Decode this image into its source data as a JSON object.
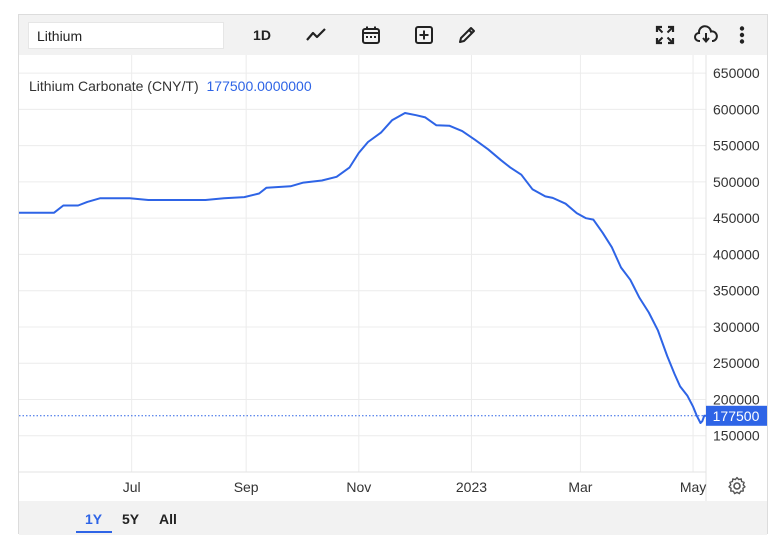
{
  "toolbar": {
    "search_value": "Lithium",
    "interval_label": "1D",
    "icons": [
      "line-chart-icon",
      "calendar-icon",
      "add-plus-icon",
      "pencil-icon",
      "fullscreen-icon",
      "cloud-download-icon",
      "more-vertical-icon"
    ]
  },
  "legend": {
    "series_label": "Lithium Carbonate (CNY/T)",
    "series_value": "177500.0000000"
  },
  "colors": {
    "line": "#2e64e6",
    "grid": "#ececec",
    "price_tag_bg": "#2e64e6",
    "price_tag_text": "#ffffff"
  },
  "ranges": {
    "items": [
      "1Y",
      "5Y",
      "All"
    ],
    "selected": "1Y"
  },
  "chart_data": {
    "type": "line",
    "title": "",
    "xlabel": "",
    "ylabel": "",
    "x_tick_labels": [
      "Jul",
      "Sep",
      "Nov",
      "2023",
      "Mar",
      "May"
    ],
    "x_tick_dates": [
      "2022-07-01",
      "2022-09-01",
      "2022-11-01",
      "2023-01-01",
      "2023-03-01",
      "2023-05-01"
    ],
    "y_tick_labels": [
      "650000",
      "600000",
      "550000",
      "500000",
      "450000",
      "400000",
      "350000",
      "300000",
      "250000",
      "200000",
      "150000"
    ],
    "ylim": [
      100000,
      675000
    ],
    "xlim": [
      "2022-05-01",
      "2023-05-08"
    ],
    "grid": true,
    "last_value_label": "177500",
    "series": [
      {
        "points": [
          [
            "2022-05-01",
            457500
          ],
          [
            "2022-05-20",
            457500
          ],
          [
            "2022-05-25",
            467500
          ],
          [
            "2022-06-02",
            467500
          ],
          [
            "2022-06-07",
            472500
          ],
          [
            "2022-06-14",
            477500
          ],
          [
            "2022-06-30",
            477500
          ],
          [
            "2022-07-10",
            475000
          ],
          [
            "2022-08-10",
            475000
          ],
          [
            "2022-08-20",
            477500
          ],
          [
            "2022-08-31",
            479000
          ],
          [
            "2022-09-08",
            484000
          ],
          [
            "2022-09-12",
            492000
          ],
          [
            "2022-09-25",
            494000
          ],
          [
            "2022-10-02",
            499000
          ],
          [
            "2022-10-12",
            502000
          ],
          [
            "2022-10-20",
            507000
          ],
          [
            "2022-10-27",
            520000
          ],
          [
            "2022-11-01",
            540000
          ],
          [
            "2022-11-06",
            555000
          ],
          [
            "2022-11-13",
            568000
          ],
          [
            "2022-11-19",
            585000
          ],
          [
            "2022-11-26",
            595000
          ],
          [
            "2022-12-02",
            592000
          ],
          [
            "2022-12-07",
            589000
          ],
          [
            "2022-12-13",
            578000
          ],
          [
            "2022-12-20",
            577500
          ],
          [
            "2022-12-27",
            570000
          ],
          [
            "2023-01-03",
            558000
          ],
          [
            "2023-01-10",
            545000
          ],
          [
            "2023-01-17",
            530000
          ],
          [
            "2023-01-22",
            520000
          ],
          [
            "2023-01-28",
            510000
          ],
          [
            "2023-02-03",
            490000
          ],
          [
            "2023-02-10",
            480000
          ],
          [
            "2023-02-14",
            478000
          ],
          [
            "2023-02-21",
            470000
          ],
          [
            "2023-02-27",
            457000
          ],
          [
            "2023-03-04",
            450000
          ],
          [
            "2023-03-08",
            448000
          ],
          [
            "2023-03-13",
            430000
          ],
          [
            "2023-03-18",
            410000
          ],
          [
            "2023-03-23",
            382000
          ],
          [
            "2023-03-28",
            365000
          ],
          [
            "2023-04-02",
            340000
          ],
          [
            "2023-04-07",
            320000
          ],
          [
            "2023-04-12",
            295000
          ],
          [
            "2023-04-17",
            260000
          ],
          [
            "2023-04-21",
            235000
          ],
          [
            "2023-04-24",
            218000
          ],
          [
            "2023-04-28",
            205000
          ],
          [
            "2023-05-01",
            190000
          ],
          [
            "2023-05-03",
            177500
          ],
          [
            "2023-05-05",
            167500
          ],
          [
            "2023-05-06",
            170000
          ],
          [
            "2023-05-07",
            177500
          ],
          [
            "2023-05-08",
            177500
          ]
        ]
      }
    ]
  }
}
